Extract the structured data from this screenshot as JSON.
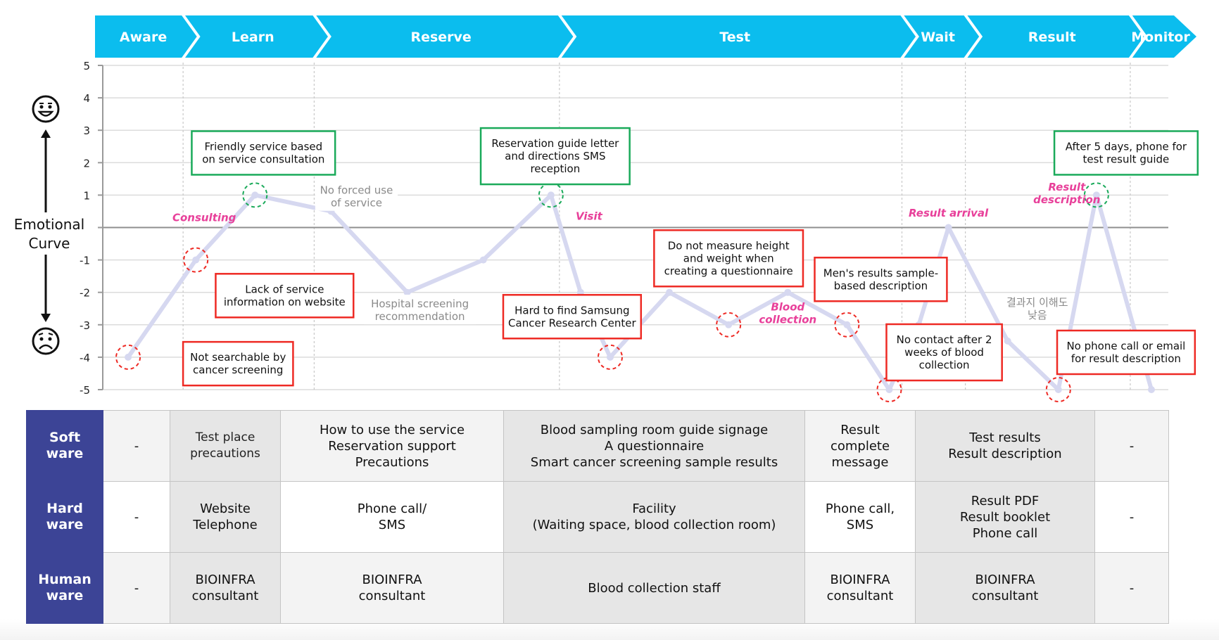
{
  "stages": [
    {
      "label": "Aware"
    },
    {
      "label": "Learn"
    },
    {
      "label": "Reserve"
    },
    {
      "label": "Test"
    },
    {
      "label": "Wait"
    },
    {
      "label": "Result"
    },
    {
      "label": "Monitor"
    }
  ],
  "side": {
    "label_line1": "Emotional",
    "label_line2": "Curve",
    "happy_icon": "happy-face-icon",
    "sad_icon": "sad-face-icon"
  },
  "colors": {
    "stage_bar": "#0bbdee",
    "curve": "#d6d8f0",
    "positive_box": "#1aaa5a",
    "negative_box": "#ee2a24",
    "moment_label": "#e8409a",
    "row_header": "#3c4496"
  },
  "chart_data": {
    "type": "line",
    "title": "Emotional Curve",
    "ylabel": "Emotional Curve",
    "ylim": [
      -5,
      5
    ],
    "yticks": [
      "5",
      "4",
      "3",
      "2",
      "1",
      "",
      "-1",
      "-2",
      "-3",
      "-4",
      "-5"
    ],
    "grid": true,
    "series": [
      {
        "name": "emotion",
        "points": [
          {
            "x": 0.3,
            "y": -4
          },
          {
            "x": 1.1,
            "y": -1
          },
          {
            "x": 1.8,
            "y": 1
          },
          {
            "x": 2.7,
            "y": 0.5
          },
          {
            "x": 3.6,
            "y": -2
          },
          {
            "x": 4.5,
            "y": -1
          },
          {
            "x": 5.3,
            "y": 1
          },
          {
            "x": 5.65,
            "y": -2
          },
          {
            "x": 6.0,
            "y": -4
          },
          {
            "x": 6.7,
            "y": -2
          },
          {
            "x": 7.4,
            "y": -3
          },
          {
            "x": 8.1,
            "y": -2
          },
          {
            "x": 8.8,
            "y": -3
          },
          {
            "x": 9.3,
            "y": -5
          },
          {
            "x": 9.65,
            "y": -3
          },
          {
            "x": 10.0,
            "y": 0
          },
          {
            "x": 10.7,
            "y": -3.5
          },
          {
            "x": 11.3,
            "y": -5
          },
          {
            "x": 11.75,
            "y": 1
          },
          {
            "x": 12.4,
            "y": -5
          }
        ]
      }
    ],
    "highlights": [
      {
        "point": 0,
        "kind": "negative"
      },
      {
        "point": 1,
        "kind": "negative"
      },
      {
        "point": 2,
        "kind": "positive"
      },
      {
        "point": 6,
        "kind": "positive"
      },
      {
        "point": 8,
        "kind": "negative"
      },
      {
        "point": 10,
        "kind": "negative"
      },
      {
        "point": 12,
        "kind": "negative"
      },
      {
        "point": 13,
        "kind": "negative"
      },
      {
        "point": 17,
        "kind": "negative"
      },
      {
        "point": 18,
        "kind": "positive"
      }
    ],
    "stage_boundaries_x": [
      0.95,
      2.5,
      5.4,
      9.45,
      10.2,
      12.15
    ],
    "x_range": [
      0,
      12.6
    ],
    "annotations": {
      "positive_boxes": [
        {
          "lines": [
            "Friendly service based",
            "on service consultation"
          ],
          "x": 1.9,
          "y": 2.3
        },
        {
          "lines": [
            "Reservation guide letter",
            "and directions SMS",
            "reception"
          ],
          "x": 5.35,
          "y": 2.2
        },
        {
          "lines": [
            "After 5 days, phone for",
            "test result guide"
          ],
          "x": 12.1,
          "y": 2.3
        }
      ],
      "negative_boxes": [
        {
          "lines": [
            "Not searchable by",
            "cancer screening"
          ],
          "x": 1.6,
          "y": -4.2
        },
        {
          "lines": [
            "Lack of service",
            "information on website"
          ],
          "x": 2.15,
          "y": -2.1
        },
        {
          "lines": [
            "Hard to find Samsung",
            "Cancer Research Center"
          ],
          "x": 5.55,
          "y": -2.75
        },
        {
          "lines": [
            "Do not measure height",
            "and weight when",
            "creating a questionnaire"
          ],
          "x": 7.4,
          "y": -0.95
        },
        {
          "lines": [
            "Men's results sample-",
            "based description"
          ],
          "x": 9.2,
          "y": -1.6
        },
        {
          "lines": [
            "No contact after 2",
            "weeks of blood",
            "collection"
          ],
          "x": 9.95,
          "y": -3.85
        },
        {
          "lines": [
            "No phone call or email",
            "for result description"
          ],
          "x": 12.1,
          "y": -3.85
        }
      ],
      "gray_notes": [
        {
          "lines": [
            "No forced use",
            "of service"
          ],
          "x": 3.0,
          "y": 0.95
        },
        {
          "lines": [
            "Hospital screening",
            "recommendation"
          ],
          "x": 3.75,
          "y": -2.55
        },
        {
          "lines": [
            "결과지 이해도",
            "낮음"
          ],
          "x": 11.05,
          "y": -2.5
        }
      ],
      "moment_labels": [
        {
          "lines": [
            "Consulting"
          ],
          "x": 1.2,
          "y": 0.3
        },
        {
          "lines": [
            "Visit"
          ],
          "x": 5.75,
          "y": 0.35
        },
        {
          "lines": [
            "Blood",
            "collection"
          ],
          "x": 8.1,
          "y": -2.65
        },
        {
          "lines": [
            "Result arrival"
          ],
          "x": 10.0,
          "y": 0.45
        },
        {
          "lines": [
            "Result",
            "description"
          ],
          "x": 11.4,
          "y": 1.05
        }
      ]
    }
  },
  "table": {
    "columns": [
      "Aware",
      "Learn",
      "Reserve",
      "Test",
      "Wait",
      "Result",
      "Monitor"
    ],
    "rows": [
      {
        "header": "Soft\nware",
        "cells": [
          "-",
          "Test place\nprecautions",
          "How to use the service\nReservation support\nPrecautions",
          "Blood sampling room guide signage\nA questionnaire\nSmart cancer screening sample results",
          "Result\ncomplete\nmessage",
          "Test results\nResult description",
          "-"
        ]
      },
      {
        "header": "Hard\nware",
        "cells": [
          "-",
          "Website\nTelephone",
          "Phone call/\nSMS",
          "Facility\n(Waiting space, blood collection room)",
          "Phone call,\nSMS",
          "Result PDF\nResult booklet\nPhone call",
          "-"
        ]
      },
      {
        "header": "Human\nware",
        "cells": [
          "-",
          "BIOINFRA\nconsultant",
          "BIOINFRA\nconsultant",
          "Blood collection staff",
          "BIOINFRA\nconsultant",
          "BIOINFRA\nconsultant",
          "-"
        ]
      }
    ]
  }
}
